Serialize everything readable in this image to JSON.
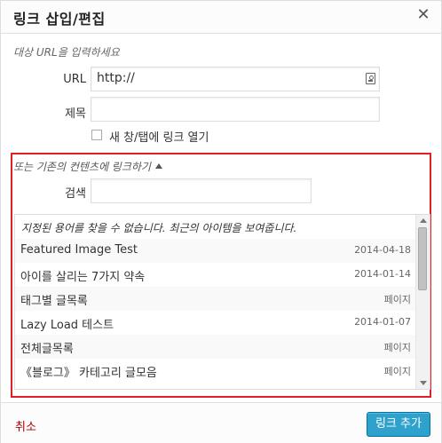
{
  "dialog": {
    "title": "링크 삽입/편집",
    "close_icon": "close-icon"
  },
  "form": {
    "hint": "대상 URL을 입력하세요",
    "url_label": "URL",
    "url_value": "http://",
    "title_label": "제목",
    "title_value": "",
    "new_tab_label": "새 창/탭에 링크 열기",
    "new_tab_checked": false
  },
  "existing": {
    "toggle_label": "또는 기존의 컨텐츠에 링크하기",
    "search_label": "검색",
    "search_value": "",
    "message": "지정된 용어를 찾을 수 없습니다. 최근의 아이템을 보여줍니다.",
    "items": [
      {
        "title": "Featured Image Test",
        "meta": "2014-04-18"
      },
      {
        "title": "아이를 살리는 7가지 약속",
        "meta": "2014-01-14"
      },
      {
        "title": "태그별 글목록",
        "meta": "페이지"
      },
      {
        "title": "Lazy Load 테스트",
        "meta": "2014-01-07"
      },
      {
        "title": "전체글목록",
        "meta": "페이지"
      },
      {
        "title": "《블로그》 카테고리 글모음",
        "meta": "페이지"
      }
    ]
  },
  "footer": {
    "cancel_label": "취소",
    "submit_label": "링크 추가"
  },
  "colors": {
    "accent": "#2ea2cc",
    "highlight_border": "#e21e26",
    "cancel": "#aa0000"
  }
}
